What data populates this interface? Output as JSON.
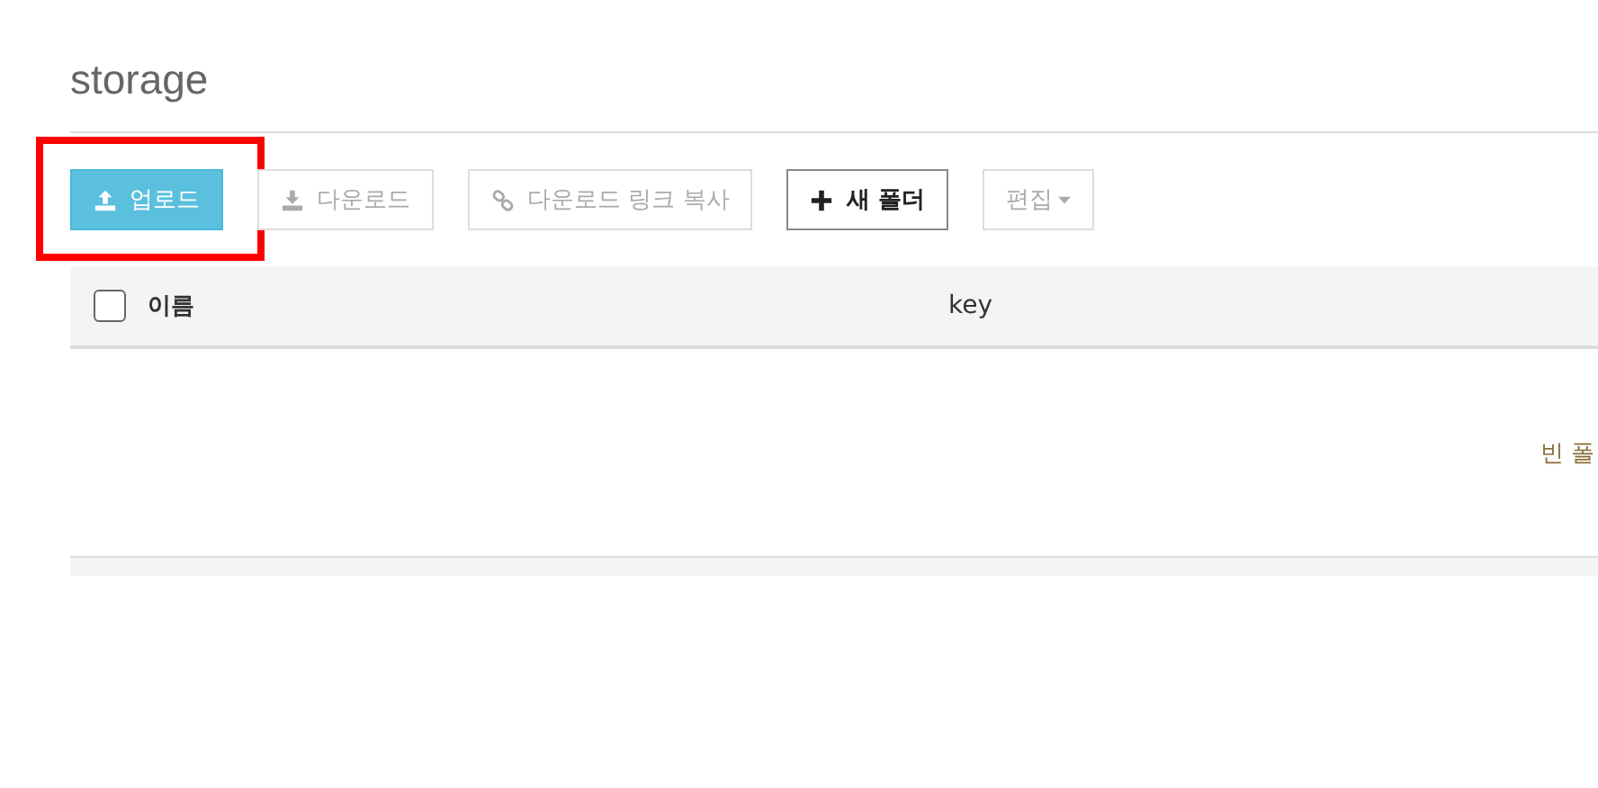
{
  "title": "storage",
  "toolbar": [
    {
      "kind": "primary",
      "label": "업로드",
      "disabled": false,
      "highlighted": true
    },
    {
      "kind": "default",
      "label": "다운로드",
      "disabled": true,
      "highlighted": false
    },
    {
      "kind": "default",
      "label": "다운로드 링크 복사",
      "disabled": true,
      "highlighted": false
    },
    {
      "kind": "default",
      "label": "새 폴더",
      "disabled": false,
      "highlighted": false
    },
    {
      "kind": "dropdown",
      "label": "편집",
      "disabled": true,
      "highlighted": false
    }
  ],
  "table": {
    "select_all": {
      "checked": false
    },
    "columns": [
      "이름",
      "key"
    ],
    "empty_message": "빈 폴"
  }
}
